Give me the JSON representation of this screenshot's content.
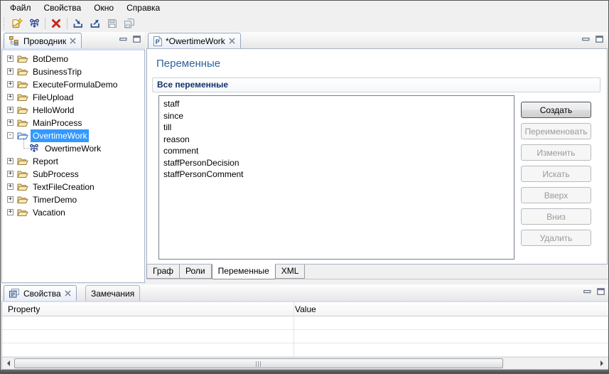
{
  "menu": {
    "items": [
      "Файл",
      "Свойства",
      "Окно",
      "Справка"
    ]
  },
  "toolbar": {
    "icons": [
      "new-process-icon",
      "bot-station-icon",
      "delete-icon",
      "import-icon",
      "export-icon",
      "save-icon",
      "save-all-icon"
    ]
  },
  "explorer": {
    "title": "Проводник",
    "items": [
      {
        "label": "BotDemo"
      },
      {
        "label": "BusinessTrip"
      },
      {
        "label": "ExecuteFormulaDemo"
      },
      {
        "label": "FileUpload"
      },
      {
        "label": "HelloWorld"
      },
      {
        "label": "MainProcess"
      },
      {
        "label": "OvertimeWork",
        "selected": true,
        "expanded": true
      },
      {
        "label": "OwertimeWork",
        "child": true
      },
      {
        "label": "Report"
      },
      {
        "label": "SubProcess"
      },
      {
        "label": "TextFileCreation"
      },
      {
        "label": "TimerDemo"
      },
      {
        "label": "Vacation"
      }
    ]
  },
  "editor": {
    "tab": "*OwertimeWork",
    "heading": "Переменные",
    "section": "Все переменные",
    "variables": [
      "staff",
      "since",
      "till",
      "reason",
      "comment",
      "staffPersonDecision",
      "staffPersonComment"
    ],
    "buttons": [
      {
        "label": "Создать",
        "enabled": true
      },
      {
        "label": "Переименовать",
        "enabled": false
      },
      {
        "label": "Изменить",
        "enabled": false
      },
      {
        "label": "Искать",
        "enabled": false
      },
      {
        "label": "Вверх",
        "enabled": false
      },
      {
        "label": "Вниз",
        "enabled": false
      },
      {
        "label": "Удалить",
        "enabled": false
      }
    ],
    "tabs": [
      {
        "label": "Граф",
        "active": false
      },
      {
        "label": "Роли",
        "active": false
      },
      {
        "label": "Переменные",
        "active": true
      },
      {
        "label": "XML",
        "active": false
      }
    ]
  },
  "properties": {
    "tabs": [
      {
        "label": "Свойства",
        "active": true
      },
      {
        "label": "Замечания",
        "active": false
      }
    ],
    "columns": [
      "Property",
      "Value"
    ],
    "rows": []
  },
  "colors": {
    "selection": "#3399ff",
    "heading": "#2e62a0",
    "section_title": "#10316c",
    "delete_icon": "#c5281c",
    "tab_underline": "#d2def2"
  }
}
